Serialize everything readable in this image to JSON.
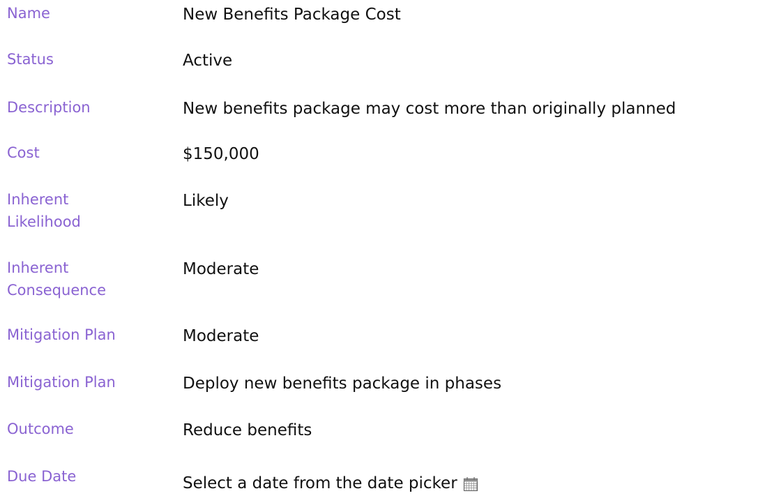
{
  "fields": [
    {
      "label": "Name",
      "value": "New Benefits Package Cost"
    },
    {
      "label": "Status",
      "value": "Active"
    },
    {
      "label": "Description",
      "value": "New benefits package may cost more than originally planned"
    },
    {
      "label": "Cost",
      "value": "$150,000"
    },
    {
      "label": "Inherent Likelihood",
      "value": "Likely"
    },
    {
      "label": "Inherent Consequence",
      "value": "Moderate"
    },
    {
      "label": "Mitigation Plan",
      "value": "Moderate"
    },
    {
      "label": "Mitigation Plan",
      "value": "Deploy new benefits package in phases"
    },
    {
      "label": "Outcome",
      "value": "Reduce benefits"
    }
  ],
  "due_date": {
    "label": "Due Date",
    "placeholder": "Select a date from the date picker",
    "icon": "calendar-icon"
  }
}
